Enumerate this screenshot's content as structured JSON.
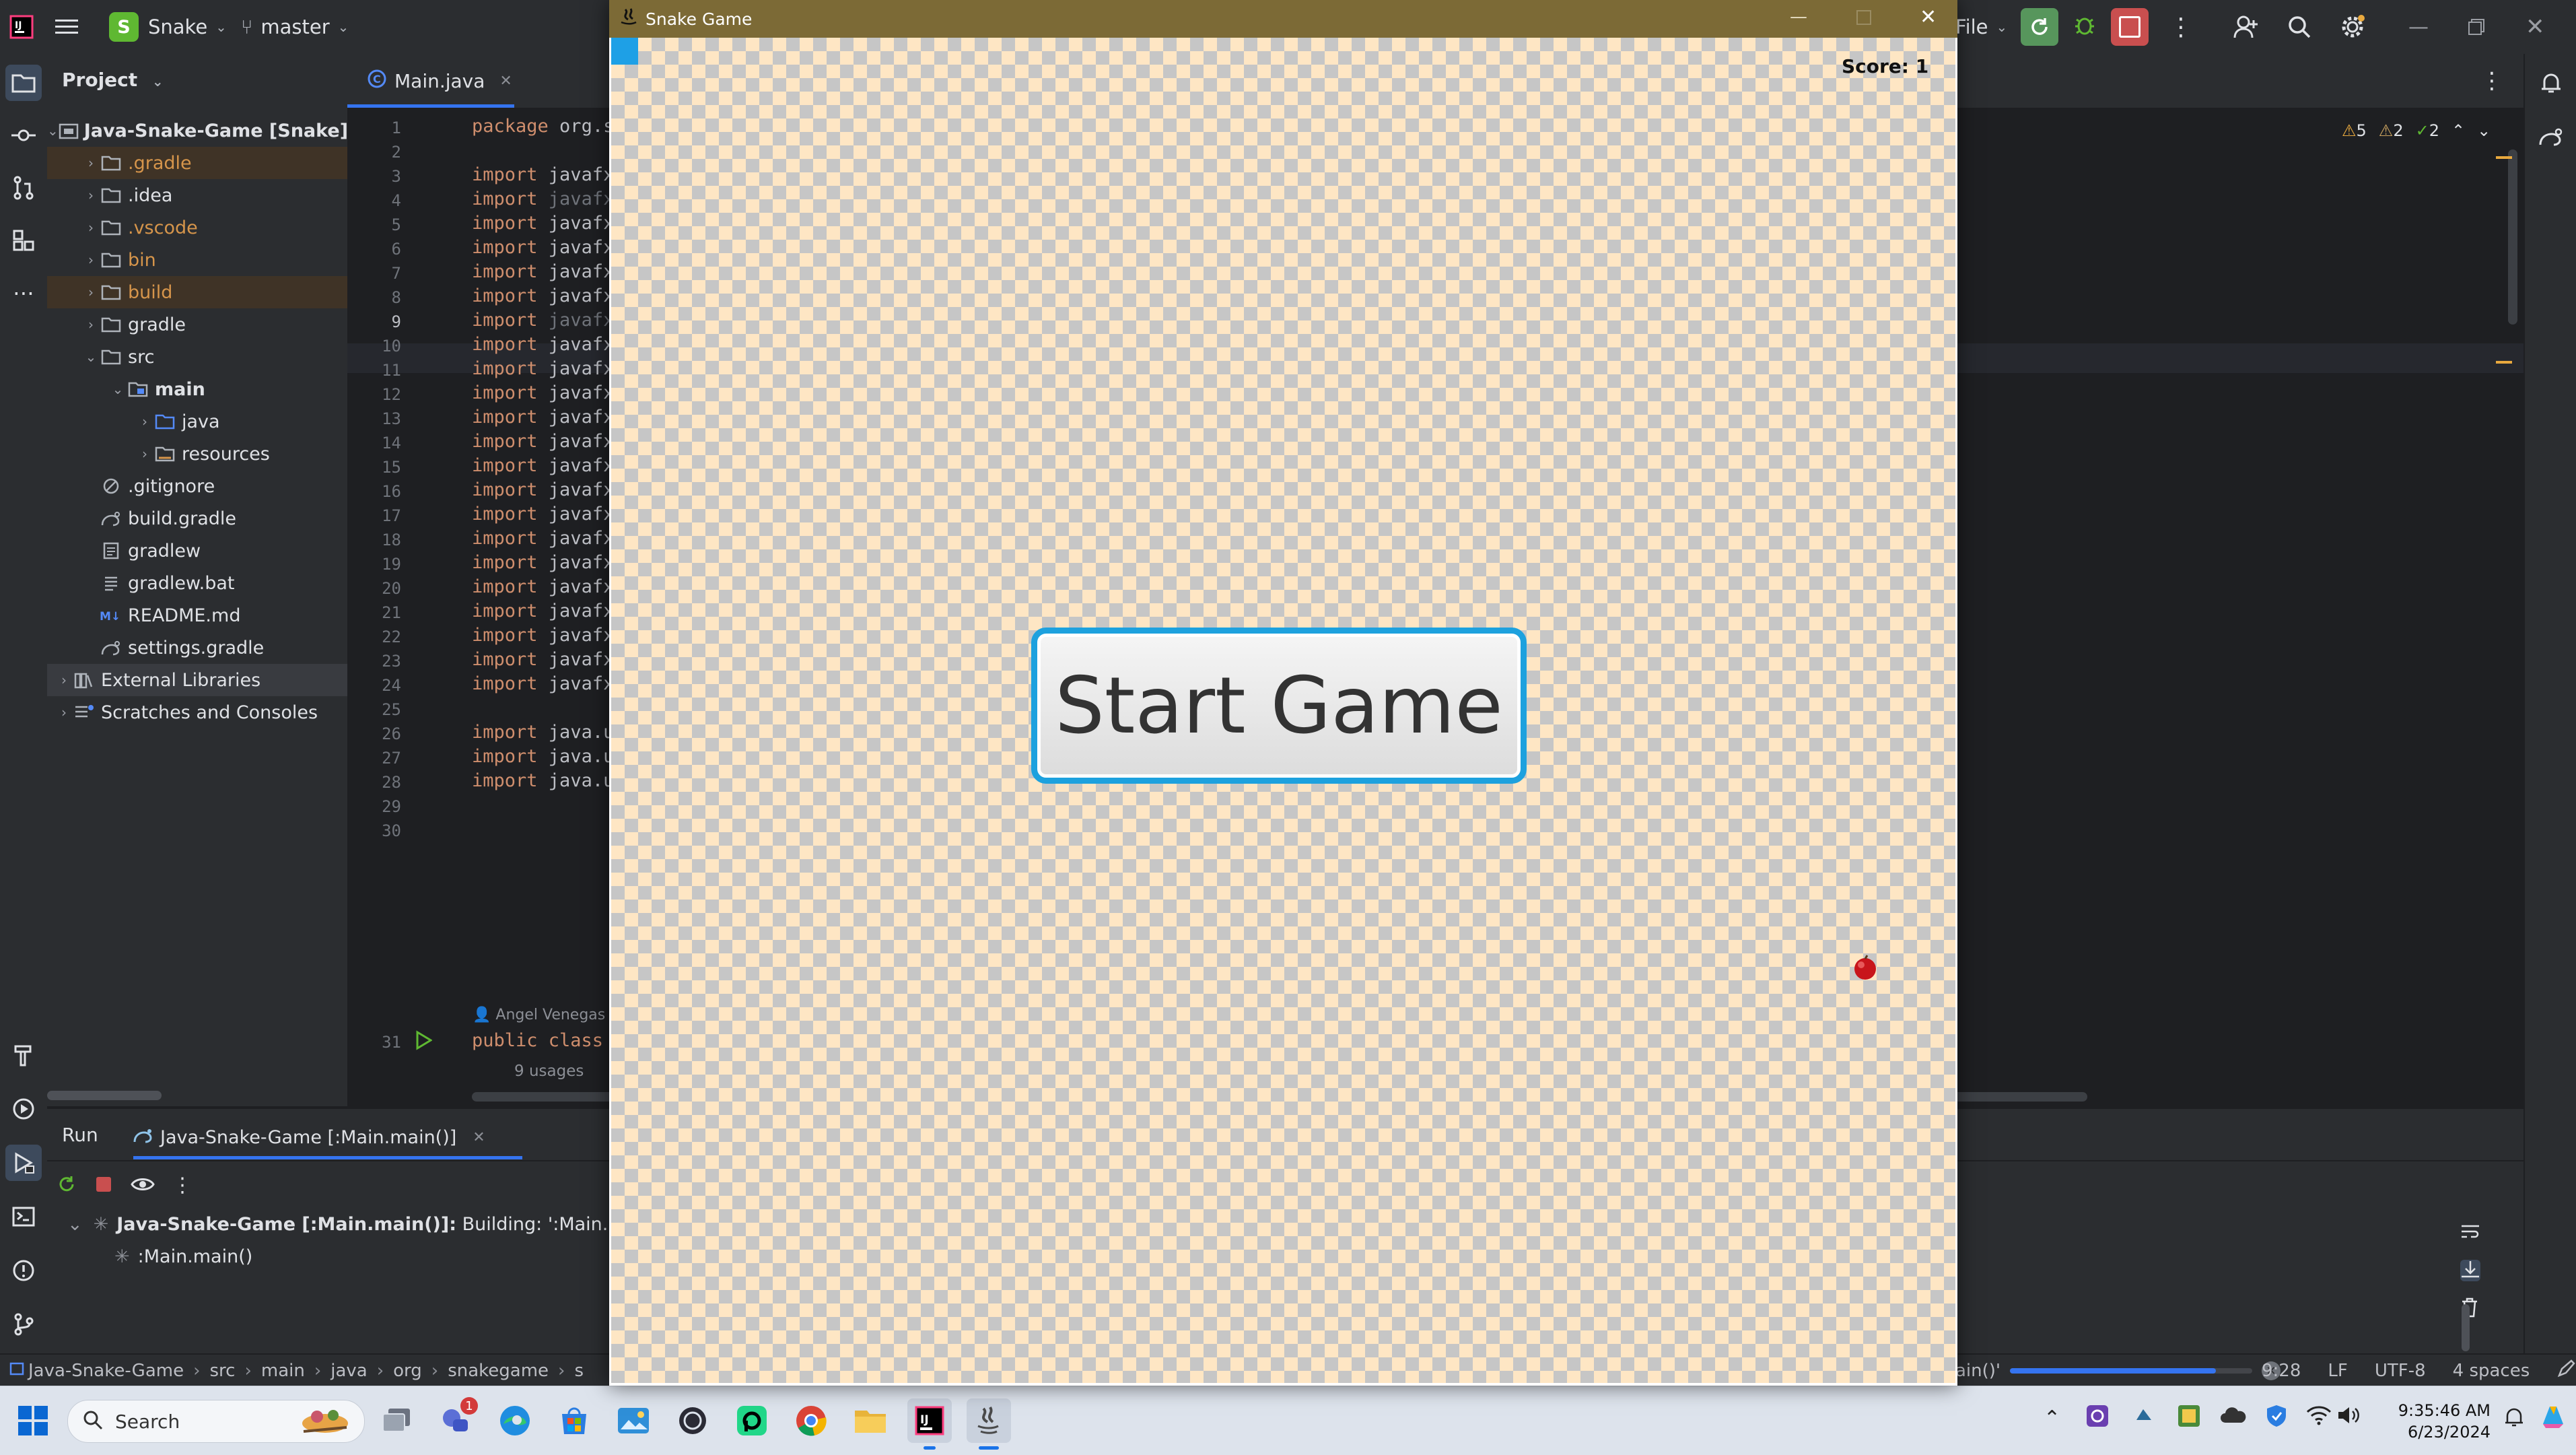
{
  "ide": {
    "project_name": "Snake",
    "project_initial": "S",
    "branch": "master",
    "title_right_file": "File",
    "project_panel_title": "Project",
    "tree": [
      {
        "label": "Java-Snake-Game [Snake]",
        "depth": 0,
        "icon": "module-icon",
        "expanded": true,
        "style": "bold"
      },
      {
        "label": ".gradle",
        "depth": 1,
        "icon": "folder-icon",
        "expanded": false,
        "style": "orange"
      },
      {
        "label": ".idea",
        "depth": 1,
        "icon": "folder-icon",
        "expanded": false,
        "style": ""
      },
      {
        "label": ".vscode",
        "depth": 1,
        "icon": "folder-icon",
        "expanded": false,
        "style": "orange"
      },
      {
        "label": "bin",
        "depth": 1,
        "icon": "folder-icon",
        "expanded": false,
        "style": "orange"
      },
      {
        "label": "build",
        "depth": 1,
        "icon": "folder-icon",
        "expanded": false,
        "style": "orange"
      },
      {
        "label": "gradle",
        "depth": 1,
        "icon": "folder-icon",
        "expanded": false,
        "style": ""
      },
      {
        "label": "src",
        "depth": 1,
        "icon": "folder-icon",
        "expanded": true,
        "style": ""
      },
      {
        "label": "main",
        "depth": 2,
        "icon": "source-folder-icon",
        "expanded": true,
        "style": "bold"
      },
      {
        "label": "java",
        "depth": 3,
        "icon": "java-folder-icon",
        "expanded": false,
        "style": ""
      },
      {
        "label": "resources",
        "depth": 3,
        "icon": "resources-folder-icon",
        "expanded": false,
        "style": ""
      },
      {
        "label": ".gitignore",
        "depth": 1,
        "icon": "ignore-file-icon",
        "expanded": null,
        "style": ""
      },
      {
        "label": "build.gradle",
        "depth": 1,
        "icon": "gradle-file-icon",
        "expanded": null,
        "style": ""
      },
      {
        "label": "gradlew",
        "depth": 1,
        "icon": "script-file-icon",
        "expanded": null,
        "style": ""
      },
      {
        "label": "gradlew.bat",
        "depth": 1,
        "icon": "text-file-icon",
        "expanded": null,
        "style": ""
      },
      {
        "label": "README.md",
        "depth": 1,
        "icon": "markdown-file-icon",
        "expanded": null,
        "style": ""
      },
      {
        "label": "settings.gradle",
        "depth": 1,
        "icon": "gradle-file-icon",
        "expanded": null,
        "style": ""
      },
      {
        "label": "External Libraries",
        "depth": 0,
        "icon": "library-icon",
        "expanded": false,
        "style": ""
      },
      {
        "label": "Scratches and Consoles",
        "depth": 0,
        "icon": "scratches-icon",
        "expanded": false,
        "style": ""
      }
    ],
    "editor_tab": "Main.java",
    "inspections": {
      "warnings": "5",
      "weak": "2",
      "ok": "2"
    },
    "code_lines": [
      {
        "n": "1",
        "text": "package org.s"
      },
      {
        "n": "2",
        "text": ""
      },
      {
        "n": "3",
        "text": "import javafx"
      },
      {
        "n": "4",
        "text": "import javafx"
      },
      {
        "n": "5",
        "text": "import javafx"
      },
      {
        "n": "6",
        "text": "import javafx"
      },
      {
        "n": "7",
        "text": "import javafx"
      },
      {
        "n": "8",
        "text": "import javafx"
      },
      {
        "n": "9",
        "text": "import javafx"
      },
      {
        "n": "10",
        "text": "import javafx"
      },
      {
        "n": "11",
        "text": "import javafx"
      },
      {
        "n": "12",
        "text": "import javafx"
      },
      {
        "n": "13",
        "text": "import javafx"
      },
      {
        "n": "14",
        "text": "import javafx"
      },
      {
        "n": "15",
        "text": "import javafx"
      },
      {
        "n": "16",
        "text": "import javafx"
      },
      {
        "n": "17",
        "text": "import javafx"
      },
      {
        "n": "18",
        "text": "import javafx"
      },
      {
        "n": "19",
        "text": "import javafx"
      },
      {
        "n": "20",
        "text": "import javafx"
      },
      {
        "n": "21",
        "text": "import javafx"
      },
      {
        "n": "22",
        "text": "import javafx"
      },
      {
        "n": "23",
        "text": "import javafx"
      },
      {
        "n": "24",
        "text": "import javafx"
      },
      {
        "n": "25",
        "text": ""
      },
      {
        "n": "26",
        "text": "import java.u"
      },
      {
        "n": "27",
        "text": "import java.u"
      },
      {
        "n": "28",
        "text": "import java.u"
      },
      {
        "n": "29",
        "text": ""
      },
      {
        "n": "30",
        "text": ""
      }
    ],
    "author_hint": "Angel Venegas",
    "line31_num": "31",
    "line31_text": "public class",
    "usages": "9 usages",
    "run": {
      "tab_run": "Run",
      "tab_config": "Java-Snake-Game [:Main.main()]",
      "build_bold": "Java-Snake-Game [:Main.main()]:",
      "build_status": "Building: ':Main.main()'",
      "child_task": ":Main.main()"
    },
    "status": {
      "breadcrumb": [
        "Java-Snake-Game",
        "src",
        "main",
        "java",
        "org",
        "snakegame",
        "s"
      ],
      "task_tail": "ain()'",
      "position": "9:28",
      "line_sep": "LF",
      "encoding": "UTF-8",
      "indent": "4 spaces",
      "progress": 0.85
    }
  },
  "snake_window": {
    "title": "Snake Game",
    "score_text": "Score: 1",
    "start_button": "Start Game",
    "colors": {
      "light_tile": "#fee6c4",
      "dark_tile": "#c6c6c6",
      "snake": "#1ea0e6",
      "food": "#c8151b"
    }
  },
  "taskbar": {
    "search_placeholder": "Search",
    "chat_badge": "1",
    "time": "9:35:46 AM",
    "date": "6/23/2024"
  }
}
